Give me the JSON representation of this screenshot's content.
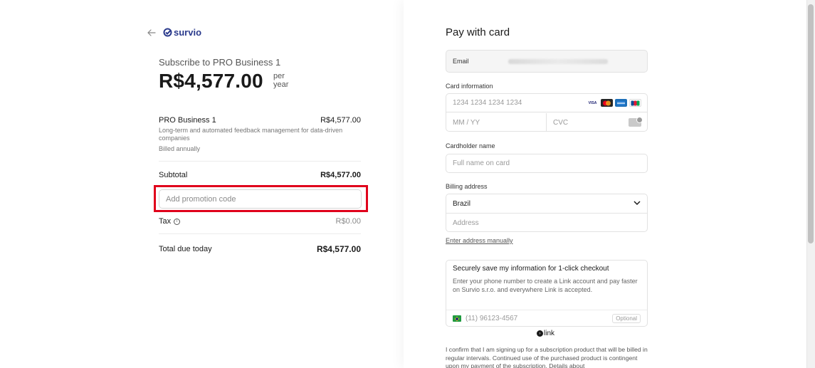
{
  "header": {
    "brand": "survio",
    "back_icon": "back-arrow-icon",
    "logo_icon": "survio-check-icon",
    "brand_color": "#2a3a8c"
  },
  "summary": {
    "subscribe_to": "Subscribe to PRO Business 1",
    "price": "R$4,577.00",
    "per_line1": "per",
    "per_line2": "year",
    "item": {
      "name": "PRO Business 1",
      "price": "R$4,577.00",
      "description": "Long-term and automated feedback management for data-driven companies",
      "billing": "Billed annually"
    },
    "subtotal_label": "Subtotal",
    "subtotal_value": "R$4,577.00",
    "promo_placeholder": "Add promotion code",
    "highlight_color": "#e0001b",
    "tax_label": "Tax",
    "tax_value": "R$0.00",
    "total_label": "Total due today",
    "total_value": "R$4,577.00"
  },
  "payment": {
    "title": "Pay with card",
    "email_label": "Email",
    "card_info_label": "Card information",
    "card_number_placeholder": "1234 1234 1234 1234",
    "brands": [
      "VISA",
      "MC",
      "AMEX",
      "JCB"
    ],
    "expiry_placeholder": "MM / YY",
    "cvc_placeholder": "CVC",
    "cardholder_label": "Cardholder name",
    "cardholder_placeholder": "Full name on card",
    "billing_label": "Billing address",
    "country": "Brazil",
    "address_placeholder": "Address",
    "manual_link": "Enter address manually",
    "link_title": "Securely save my information for 1-click checkout",
    "link_desc": "Enter your phone number to create a Link account and pay faster on Survio s.r.o. and everywhere Link is accepted.",
    "phone_placeholder": "(11) 96123-4567",
    "optional": "Optional",
    "link_brand": "link",
    "confirm_text": "I confirm that I am signing up for a subscription product that will be billed in regular intervals. Continued use of the purchased product is contingent upon my payment of the subscription. Details about"
  }
}
